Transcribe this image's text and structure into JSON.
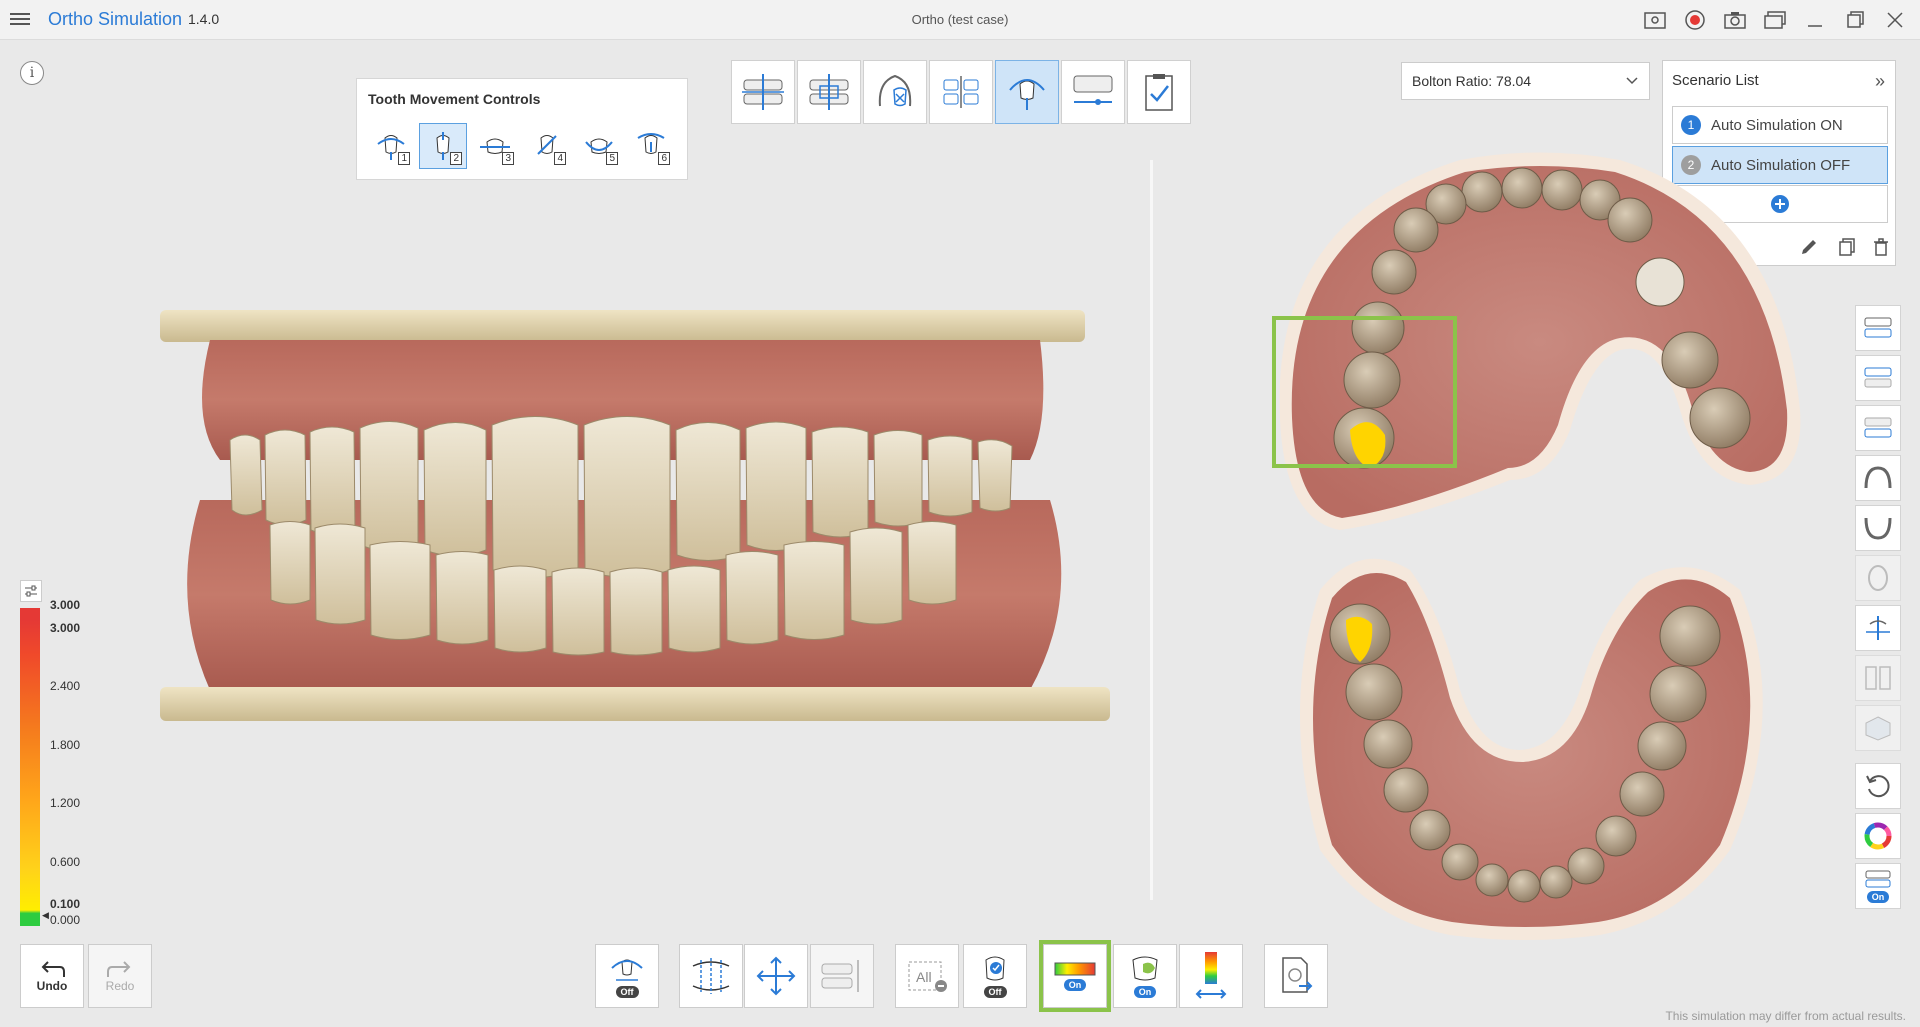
{
  "titlebar": {
    "app_name": "Ortho Simulation",
    "version": "1.4.0",
    "window_title": "Ortho (test case)"
  },
  "tooth_movement_controls": {
    "title": "Tooth Movement Controls",
    "buttons": [
      {
        "number": "1",
        "active": false
      },
      {
        "number": "2",
        "active": true
      },
      {
        "number": "3",
        "active": false
      },
      {
        "number": "4",
        "active": false
      },
      {
        "number": "5",
        "active": false
      },
      {
        "number": "6",
        "active": false
      }
    ]
  },
  "bolton": {
    "label": "Bolton Ratio: 78.04"
  },
  "scenario_list": {
    "title": "Scenario List",
    "items": [
      {
        "number": "1",
        "label": "Auto Simulation ON",
        "selected": false,
        "color": "#2b7bd6"
      },
      {
        "number": "2",
        "label": "Auto Simulation OFF",
        "selected": true,
        "color": "#9e9e9e"
      }
    ]
  },
  "color_scale": {
    "labels": [
      "3.000",
      "3.000",
      "2.400",
      "1.800",
      "1.200",
      "0.600",
      "0.100",
      "0.000"
    ],
    "colors": {
      "high": "#e53935",
      "low": "#2ecc40",
      "mid": "#ffd21a"
    }
  },
  "bottom": {
    "undo_label": "Undo",
    "redo_label": "Redo",
    "toggle_off": "Off",
    "toggle_on": "On",
    "all_label": "All"
  },
  "disclaimer": "This simulation may differ from actual results.",
  "accent_color": "#2b7bd6",
  "highlight_color": "#8bc34a"
}
